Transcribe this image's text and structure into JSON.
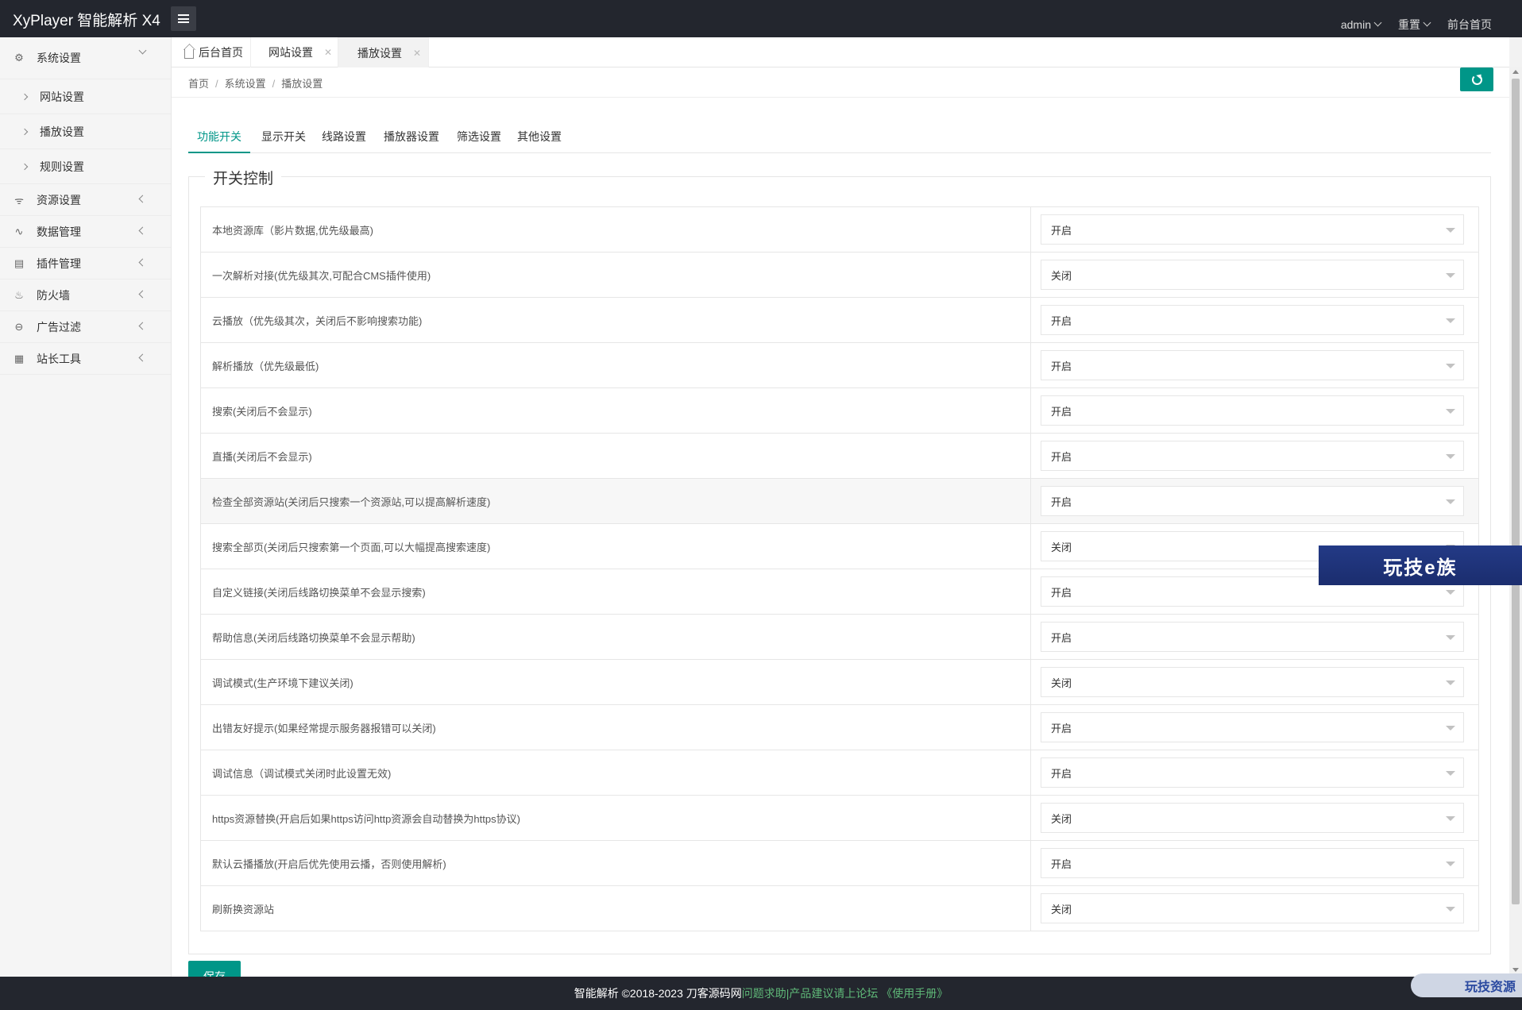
{
  "header": {
    "title": "XyPlayer 智能解析 X4",
    "user": "admin",
    "reset": "重置",
    "frontpage": "前台首页"
  },
  "sidebar": {
    "items": [
      {
        "label": "系统设置",
        "icon": "gear-icon"
      },
      {
        "label": "资源设置",
        "icon": "rss-icon"
      },
      {
        "label": "数据管理",
        "icon": "pulse-icon"
      },
      {
        "label": "插件管理",
        "icon": "plugin-icon"
      },
      {
        "label": "防火墙",
        "icon": "fire-icon"
      },
      {
        "label": "广告过滤",
        "icon": "minus-circle-icon"
      },
      {
        "label": "站长工具",
        "icon": "tools-icon"
      }
    ],
    "subitems": [
      "网站设置",
      "播放设置",
      "规则设置"
    ]
  },
  "tabs": [
    "后台首页",
    "网站设置",
    "播放设置"
  ],
  "breadcrumb": [
    "首页",
    "系统设置",
    "播放设置"
  ],
  "subtabs": [
    "功能开关",
    "显示开关",
    "线路设置",
    "播放器设置",
    "筛选设置",
    "其他设置"
  ],
  "section_title": "开关控制",
  "rows": [
    {
      "label": "本地资源库（影片数据,优先级最高)",
      "value": "开启"
    },
    {
      "label": "一次解析对接(优先级其次,可配合CMS插件使用)",
      "value": "关闭"
    },
    {
      "label": "云播放（优先级其次，关闭后不影响搜索功能)",
      "value": "开启"
    },
    {
      "label": "解析播放（优先级最低)",
      "value": "开启"
    },
    {
      "label": "搜索(关闭后不会显示)",
      "value": "开启"
    },
    {
      "label": "直播(关闭后不会显示)",
      "value": "开启"
    },
    {
      "label": "检查全部资源站(关闭后只搜索一个资源站,可以提高解析速度)",
      "value": "开启"
    },
    {
      "label": "搜索全部页(关闭后只搜索第一个页面,可以大幅提高搜索速度)",
      "value": "关闭"
    },
    {
      "label": "自定义链接(关闭后线路切换菜单不会显示搜索)",
      "value": "开启"
    },
    {
      "label": "帮助信息(关闭后线路切换菜单不会显示帮助)",
      "value": "开启"
    },
    {
      "label": "调试模式(生产环境下建议关闭)",
      "value": "关闭"
    },
    {
      "label": "出错友好提示(如果经常提示服务器报错可以关闭)",
      "value": "开启"
    },
    {
      "label": "调试信息（调试模式关闭时此设置无效)",
      "value": "开启"
    },
    {
      "label": "https资源替换(开启后如果https访问http资源会自动替换为https协议)",
      "value": "关闭"
    },
    {
      "label": "默认云播播放(开启后优先使用云播，否则使用解析)",
      "value": "开启"
    },
    {
      "label": "刷新换资源站",
      "value": "关闭"
    }
  ],
  "save_label": "保存",
  "footer": {
    "text": "智能解析 ©2018-2023 刀客源码网",
    "links": "问题求助|产品建议请上论坛 《使用手册》"
  },
  "watermarks": [
    "玩技e族",
    "玩技资源"
  ],
  "colors": {
    "accent": "#009688",
    "header_bg": "#23262e"
  }
}
